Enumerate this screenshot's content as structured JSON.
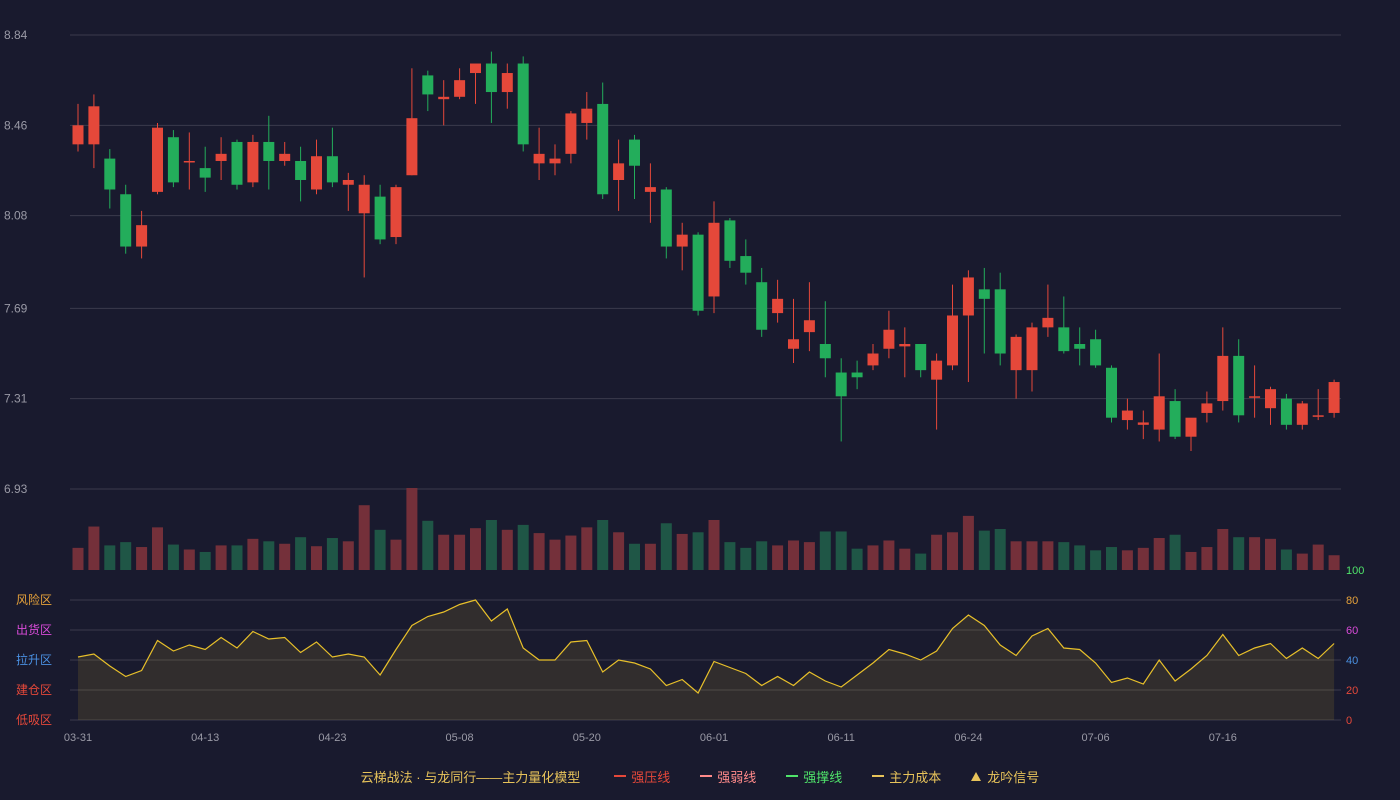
{
  "colors": {
    "background": "#191a2e",
    "up": "#e5483a",
    "down": "#23ad5b",
    "volume_up": "#74303a",
    "volume_down": "#1f5646",
    "grid": "#3a3b4c",
    "indicator_line": "#e8c02a",
    "axis_text": "#9a9aa6"
  },
  "legend": {
    "title": "云梯战法 · 与龙同行——主力量化模型",
    "items": [
      {
        "label": "强压线",
        "color": "#e5483a",
        "style": "solid",
        "icon": "solid-line-icon"
      },
      {
        "label": "强弱线",
        "color": "#ff8a8a",
        "style": "dashed",
        "icon": "dashed-line-icon"
      },
      {
        "label": "强撑线",
        "color": "#4fe36a",
        "style": "solid",
        "icon": "solid-line-icon"
      },
      {
        "label": "主力成本",
        "color": "#e7c35a",
        "style": "dashed",
        "icon": "dashed-line-icon"
      },
      {
        "label": "龙吟信号",
        "color": "#e7c35a",
        "style": "triangle",
        "icon": "triangle-icon"
      }
    ]
  },
  "chart_data": {
    "type": "candlestick",
    "price_axis": {
      "ticks": [
        "8.84",
        "8.46",
        "8.08",
        "7.69",
        "7.31",
        "6.93"
      ],
      "min": 6.93,
      "max": 8.84
    },
    "x_tick_labels": [
      {
        "index": 0,
        "label": "03-31"
      },
      {
        "index": 8,
        "label": "04-13"
      },
      {
        "index": 16,
        "label": "04-23"
      },
      {
        "index": 24,
        "label": "05-08"
      },
      {
        "index": 32,
        "label": "05-20"
      },
      {
        "index": 40,
        "label": "06-01"
      },
      {
        "index": 48,
        "label": "06-11"
      },
      {
        "index": 56,
        "label": "06-24"
      },
      {
        "index": 64,
        "label": "07-06"
      },
      {
        "index": 72,
        "label": "07-16"
      }
    ],
    "ohlc": [
      [
        8.38,
        8.46,
        8.35,
        8.55
      ],
      [
        8.38,
        8.54,
        8.28,
        8.59
      ],
      [
        8.32,
        8.19,
        8.11,
        8.36
      ],
      [
        8.17,
        7.95,
        7.92,
        8.21
      ],
      [
        7.95,
        8.04,
        7.9,
        8.1
      ],
      [
        8.18,
        8.45,
        8.17,
        8.47
      ],
      [
        8.41,
        8.22,
        8.2,
        8.44
      ],
      [
        8.31,
        8.31,
        8.19,
        8.43
      ],
      [
        8.28,
        8.24,
        8.18,
        8.37
      ],
      [
        8.31,
        8.34,
        8.23,
        8.41
      ],
      [
        8.39,
        8.21,
        8.19,
        8.4
      ],
      [
        8.22,
        8.39,
        8.2,
        8.42
      ],
      [
        8.39,
        8.31,
        8.19,
        8.5
      ],
      [
        8.31,
        8.34,
        8.29,
        8.39
      ],
      [
        8.31,
        8.23,
        8.14,
        8.37
      ],
      [
        8.19,
        8.33,
        8.17,
        8.4
      ],
      [
        8.33,
        8.22,
        8.2,
        8.45
      ],
      [
        8.21,
        8.23,
        8.1,
        8.26
      ],
      [
        8.09,
        8.21,
        7.82,
        8.25
      ],
      [
        8.16,
        7.98,
        7.96,
        8.21
      ],
      [
        7.99,
        8.2,
        7.96,
        8.21
      ],
      [
        8.25,
        8.49,
        8.25,
        8.7
      ],
      [
        8.67,
        8.59,
        8.52,
        8.69
      ],
      [
        8.57,
        8.58,
        8.46,
        8.65
      ],
      [
        8.58,
        8.65,
        8.57,
        8.7
      ],
      [
        8.68,
        8.72,
        8.55,
        8.68
      ],
      [
        8.72,
        8.6,
        8.47,
        8.77
      ],
      [
        8.6,
        8.68,
        8.53,
        8.72
      ],
      [
        8.72,
        8.38,
        8.35,
        8.75
      ],
      [
        8.3,
        8.34,
        8.23,
        8.45
      ],
      [
        8.3,
        8.32,
        8.25,
        8.38
      ],
      [
        8.34,
        8.51,
        8.3,
        8.52
      ],
      [
        8.47,
        8.53,
        8.4,
        8.6
      ],
      [
        8.55,
        8.17,
        8.15,
        8.64
      ],
      [
        8.23,
        8.3,
        8.1,
        8.4
      ],
      [
        8.4,
        8.29,
        8.15,
        8.42
      ],
      [
        8.18,
        8.2,
        8.05,
        8.3
      ],
      [
        8.19,
        7.95,
        7.9,
        8.2
      ],
      [
        7.95,
        8.0,
        7.85,
        8.05
      ],
      [
        8.0,
        7.68,
        7.66,
        8.01
      ],
      [
        7.74,
        8.05,
        7.67,
        8.14
      ],
      [
        8.06,
        7.89,
        7.86,
        8.07
      ],
      [
        7.91,
        7.84,
        7.79,
        7.98
      ],
      [
        7.8,
        7.6,
        7.57,
        7.86
      ],
      [
        7.67,
        7.73,
        7.63,
        7.81
      ],
      [
        7.52,
        7.56,
        7.46,
        7.73
      ],
      [
        7.59,
        7.64,
        7.51,
        7.8
      ],
      [
        7.54,
        7.48,
        7.4,
        7.72
      ],
      [
        7.42,
        7.32,
        7.13,
        7.48
      ],
      [
        7.42,
        7.4,
        7.35,
        7.47
      ],
      [
        7.45,
        7.5,
        7.43,
        7.54
      ],
      [
        7.52,
        7.6,
        7.48,
        7.68
      ],
      [
        7.53,
        7.54,
        7.4,
        7.61
      ],
      [
        7.54,
        7.43,
        7.4,
        7.54
      ],
      [
        7.39,
        7.47,
        7.18,
        7.5
      ],
      [
        7.45,
        7.66,
        7.43,
        7.79
      ],
      [
        7.66,
        7.82,
        7.38,
        7.85
      ],
      [
        7.77,
        7.73,
        7.5,
        7.86
      ],
      [
        7.77,
        7.5,
        7.45,
        7.84
      ],
      [
        7.43,
        7.57,
        7.31,
        7.58
      ],
      [
        7.43,
        7.61,
        7.34,
        7.63
      ],
      [
        7.61,
        7.65,
        7.57,
        7.79
      ],
      [
        7.61,
        7.51,
        7.5,
        7.74
      ],
      [
        7.54,
        7.52,
        7.45,
        7.61
      ],
      [
        7.56,
        7.45,
        7.44,
        7.6
      ],
      [
        7.44,
        7.23,
        7.21,
        7.45
      ],
      [
        7.22,
        7.26,
        7.18,
        7.31
      ],
      [
        7.2,
        7.21,
        7.14,
        7.26
      ],
      [
        7.18,
        7.32,
        7.13,
        7.5
      ],
      [
        7.3,
        7.15,
        7.14,
        7.35
      ],
      [
        7.15,
        7.23,
        7.09,
        7.22
      ],
      [
        7.25,
        7.29,
        7.21,
        7.34
      ],
      [
        7.3,
        7.49,
        7.26,
        7.61
      ],
      [
        7.49,
        7.24,
        7.21,
        7.56
      ],
      [
        7.32,
        7.32,
        7.23,
        7.45
      ],
      [
        7.27,
        7.35,
        7.2,
        7.36
      ],
      [
        7.31,
        7.2,
        7.18,
        7.33
      ],
      [
        7.2,
        7.29,
        7.18,
        7.3
      ],
      [
        7.24,
        7.24,
        7.22,
        7.35
      ],
      [
        7.25,
        7.38,
        7.23,
        7.39
      ]
    ],
    "volume_relative": [
      0.27,
      0.53,
      0.3,
      0.34,
      0.28,
      0.52,
      0.31,
      0.25,
      0.22,
      0.3,
      0.3,
      0.38,
      0.35,
      0.32,
      0.4,
      0.29,
      0.39,
      0.35,
      0.79,
      0.49,
      0.37,
      1.0,
      0.6,
      0.43,
      0.43,
      0.51,
      0.61,
      0.49,
      0.55,
      0.45,
      0.37,
      0.42,
      0.52,
      0.61,
      0.46,
      0.32,
      0.32,
      0.57,
      0.44,
      0.46,
      0.61,
      0.34,
      0.27,
      0.35,
      0.3,
      0.36,
      0.34,
      0.47,
      0.47,
      0.26,
      0.3,
      0.36,
      0.26,
      0.2,
      0.43,
      0.46,
      0.66,
      0.48,
      0.5,
      0.35,
      0.35,
      0.35,
      0.34,
      0.3,
      0.24,
      0.28,
      0.24,
      0.27,
      0.39,
      0.43,
      0.22,
      0.28,
      0.5,
      0.4,
      0.4,
      0.38,
      0.25,
      0.2,
      0.31,
      0.18
    ],
    "indicator": {
      "levels": [
        {
          "value": 100,
          "zone": "",
          "color": "#4fe36a"
        },
        {
          "value": 80,
          "zone": "风险区",
          "color": "#e7a23a"
        },
        {
          "value": 60,
          "zone": "出货区",
          "color": "#d94bd9"
        },
        {
          "value": 40,
          "zone": "拉升区",
          "color": "#4a90e2"
        },
        {
          "value": 20,
          "zone": "建仓区",
          "color": "#e5483a"
        },
        {
          "value": 0,
          "zone": "低吸区",
          "color": "#e5483a"
        }
      ],
      "values": [
        42,
        44,
        36,
        29,
        33,
        53,
        46,
        50,
        47,
        55,
        48,
        59,
        54,
        55,
        45,
        52,
        42,
        44,
        42,
        30,
        47,
        63,
        69,
        72,
        77,
        80,
        66,
        74,
        48,
        40,
        40,
        52,
        53,
        32,
        40,
        38,
        34,
        23,
        27,
        18,
        39,
        35,
        31,
        23,
        29,
        23,
        32,
        26,
        22,
        30,
        38,
        47,
        44,
        40,
        46,
        61,
        70,
        63,
        50,
        43,
        56,
        61,
        48,
        47,
        38,
        25,
        28,
        24,
        40,
        26,
        34,
        43,
        57,
        43,
        48,
        51,
        41,
        48,
        41,
        51
      ]
    }
  }
}
